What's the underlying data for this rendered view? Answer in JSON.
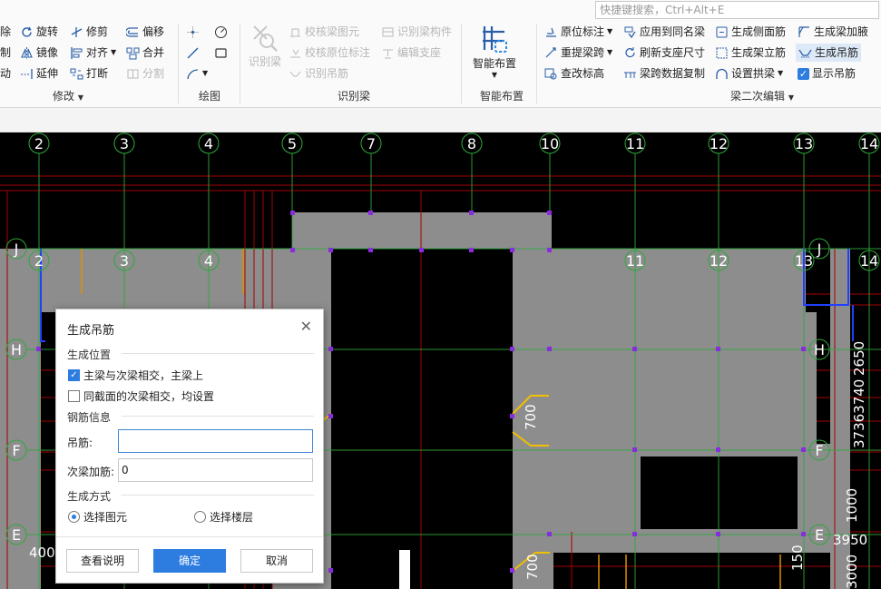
{
  "search": {
    "placeholder": "快捷键搜索，Ctrl+Alt+E"
  },
  "ribbon": {
    "modify": {
      "label": "修改",
      "items": [
        "除",
        "旋转",
        "修剪",
        "偏移",
        "制",
        "镜像",
        "对齐",
        "合并",
        "动",
        "延伸",
        "打断",
        "分割"
      ]
    },
    "draw": {
      "label": "绘图"
    },
    "recognize": {
      "label": "识别梁",
      "big": "识别梁",
      "items": [
        "校核梁图元",
        "识别梁构件",
        "校核原位标注",
        "编辑支座",
        "识别吊筋"
      ]
    },
    "smart": {
      "label": "智能布置",
      "big": "智能布置"
    },
    "edit2": {
      "label": "梁二次编辑",
      "items": [
        "原位标注",
        "应用到同名梁",
        "生成侧面筋",
        "生成梁加腋",
        "重提梁跨",
        "刷新支座尺寸",
        "生成架立筋",
        "生成吊筋",
        "查改标高",
        "梁跨数据复制",
        "设置拱梁",
        "显示吊筋"
      ]
    }
  },
  "canvas": {
    "axis_top": [
      "2",
      "3",
      "4",
      "5",
      "7",
      "8",
      "10",
      "11",
      "12",
      "13",
      "14"
    ],
    "axis_inner": [
      "2",
      "3",
      "4",
      "11",
      "12",
      "13",
      "14"
    ],
    "axis_rows": [
      "J",
      "H",
      "F",
      "E"
    ],
    "dims": [
      "700",
      "700",
      "150",
      "400",
      "37363740",
      "2650",
      "3950",
      "1000",
      "3000"
    ]
  },
  "dialog": {
    "title": "生成吊筋",
    "section_position": "生成位置",
    "opt_main": "主梁与次梁相交，主梁上",
    "opt_same_section": "同截面的次梁相交，均设置",
    "section_rebar": "钢筋信息",
    "hanger_label": "吊筋:",
    "hanger_value": "",
    "secondary_label": "次梁加筋:",
    "secondary_value": "0",
    "section_method": "生成方式",
    "radio_element": "选择图元",
    "radio_floor": "选择楼层",
    "btn_help": "查看说明",
    "btn_ok": "确定",
    "btn_cancel": "取消"
  },
  "colors": {
    "accent": "#2d7ce0",
    "axis": "#2fa83a",
    "beam": "#8f8f8f",
    "cad_red": "#b30000",
    "node": "#8a2be2",
    "yellow": "#f0c000"
  }
}
